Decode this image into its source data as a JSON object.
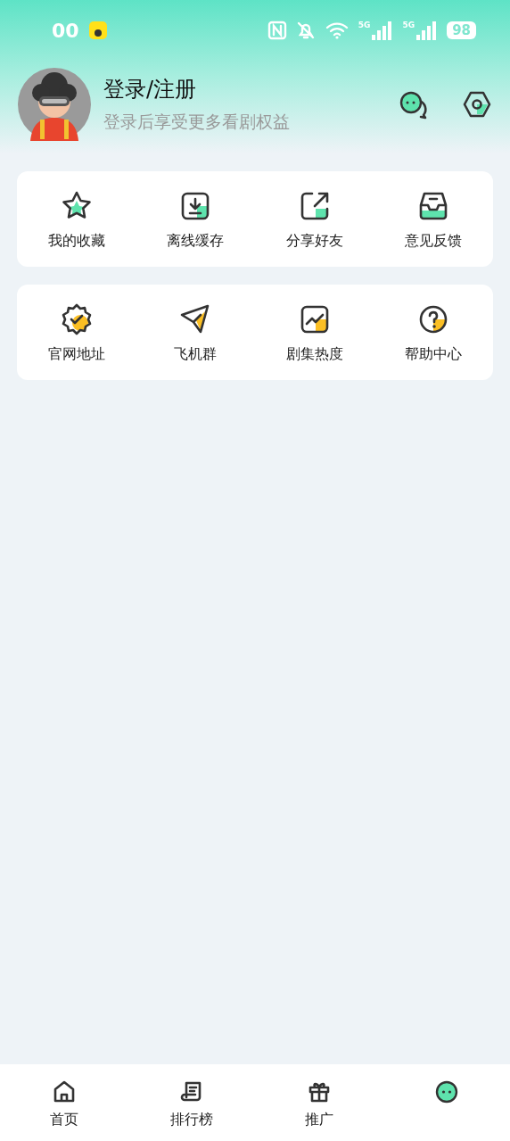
{
  "status_bar": {
    "time": "00",
    "signal_labels": [
      "5G",
      "5G"
    ],
    "battery": "98"
  },
  "profile": {
    "title": "登录/注册",
    "subtitle": "登录后享受更多看剧权益"
  },
  "menu_groups": [
    {
      "color": "#5ee3ad",
      "items": [
        {
          "label": "我的收藏",
          "kind": "star"
        },
        {
          "label": "离线缓存",
          "kind": "download"
        },
        {
          "label": "分享好友",
          "kind": "share"
        },
        {
          "label": "意见反馈",
          "kind": "inbox"
        }
      ]
    },
    {
      "color": "#fbbf24",
      "items": [
        {
          "label": "官网地址",
          "kind": "badge"
        },
        {
          "label": "飞机群",
          "kind": "plane"
        },
        {
          "label": "剧集热度",
          "kind": "trend"
        },
        {
          "label": "帮助中心",
          "kind": "help"
        }
      ]
    }
  ],
  "tab_bar": [
    {
      "label": "首页",
      "kind": "home",
      "selected": false
    },
    {
      "label": "排行榜",
      "kind": "scroll",
      "selected": false
    },
    {
      "label": "推广",
      "kind": "gift",
      "selected": false
    },
    {
      "kind": "face",
      "selected": true
    }
  ]
}
